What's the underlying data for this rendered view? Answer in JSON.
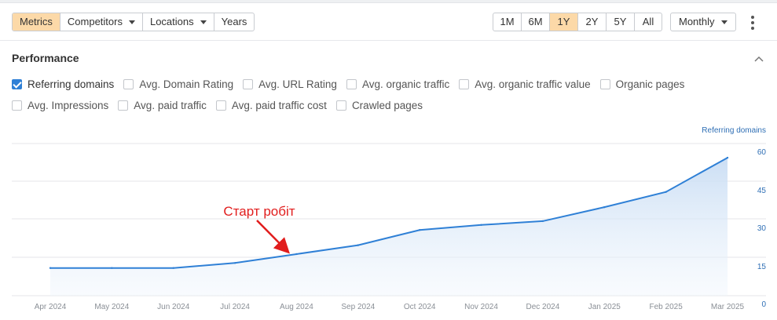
{
  "toolbar": {
    "left_tabs": [
      {
        "label": "Metrics",
        "active": true,
        "dropdown": false
      },
      {
        "label": "Competitors",
        "active": false,
        "dropdown": true
      },
      {
        "label": "Locations",
        "active": false,
        "dropdown": true
      },
      {
        "label": "Years",
        "active": false,
        "dropdown": false
      }
    ],
    "ranges": [
      "1M",
      "6M",
      "1Y",
      "2Y",
      "5Y",
      "All"
    ],
    "active_range": "1Y",
    "interval": "Monthly",
    "more_icon": "kebab-menu-icon"
  },
  "performance": {
    "title": "Performance",
    "collapse_icon": "chevron-up-icon",
    "metrics_row1": [
      {
        "label": "Referring domains",
        "checked": true
      },
      {
        "label": "Avg. Domain Rating",
        "checked": false
      },
      {
        "label": "Avg. URL Rating",
        "checked": false
      },
      {
        "label": "Avg. organic traffic",
        "checked": false
      },
      {
        "label": "Avg. organic traffic value",
        "checked": false
      },
      {
        "label": "Organic pages",
        "checked": false
      }
    ],
    "metrics_row2": [
      {
        "label": "Avg. Impressions",
        "checked": false
      },
      {
        "label": "Avg. paid traffic",
        "checked": false
      },
      {
        "label": "Avg. paid traffic cost",
        "checked": false
      },
      {
        "label": "Crawled pages",
        "checked": false
      }
    ]
  },
  "colors": {
    "accent_orange": "#fcd9a8",
    "line_blue": "#2f80d6",
    "axis_blue": "#2f6fb5",
    "annotation_red": "#e11d1d"
  },
  "chart_data": {
    "type": "area",
    "series": [
      {
        "name": "Referring domains",
        "values": [
          14,
          14,
          14,
          16,
          19.5,
          23,
          29,
          31,
          32.5,
          38,
          44,
          57.5
        ]
      }
    ],
    "categories": [
      "Apr 2024",
      "May 2024",
      "Jun 2024",
      "Jul 2024",
      "Aug 2024",
      "Sep 2024",
      "Oct 2024",
      "Nov 2024",
      "Dec 2024",
      "Jan 2025",
      "Feb 2025",
      "Mar 2025"
    ],
    "y_ticks": [
      0,
      15,
      30,
      45,
      60
    ],
    "ylim": [
      0,
      60
    ],
    "grid": true,
    "annotation": {
      "text": "Старт робіт",
      "points_to": "Aug 2024"
    }
  }
}
